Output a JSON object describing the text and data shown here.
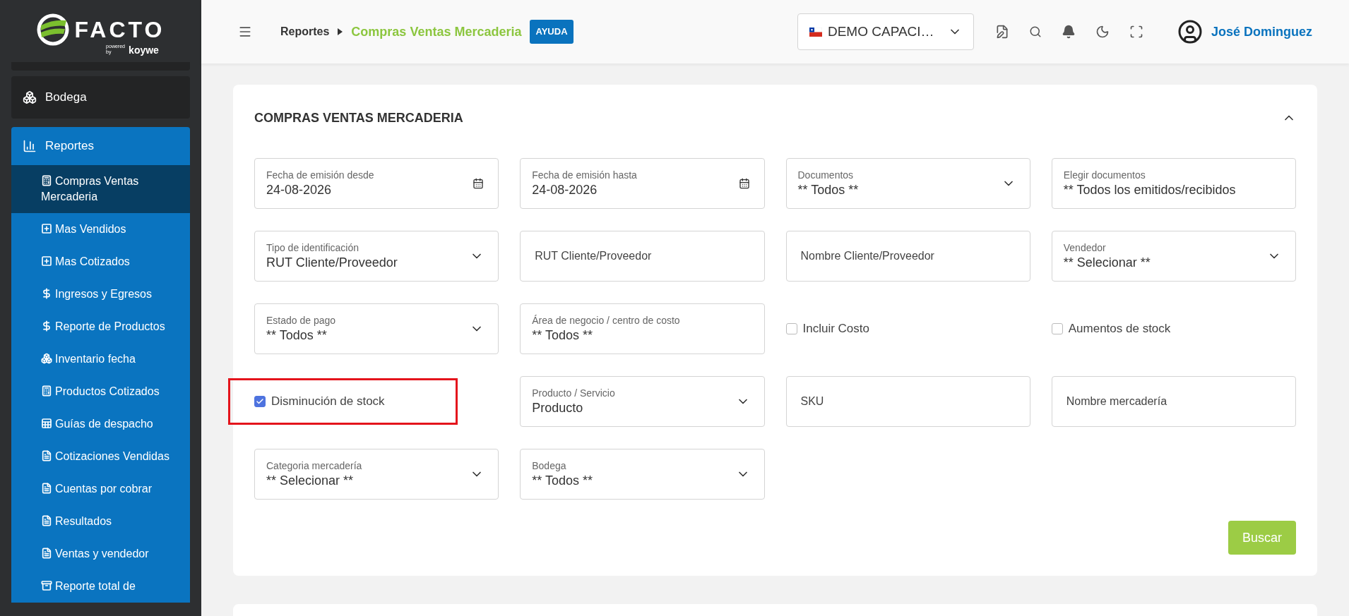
{
  "sidebar": {
    "logo": {
      "name": "FACTO",
      "tagline_small": "powered by",
      "tagline": "koywe"
    },
    "items": [
      {
        "label": "Bodega",
        "expanded": false
      },
      {
        "label": "Reportes",
        "expanded": true,
        "children": [
          {
            "label": "Compras Ventas Mercaderia",
            "selected": true
          },
          {
            "label": "Mas Vendidos",
            "selected": false
          },
          {
            "label": "Mas Cotizados",
            "selected": false
          },
          {
            "label": "Ingresos y Egresos",
            "selected": false
          },
          {
            "label": "Reporte de Productos",
            "selected": false
          },
          {
            "label": "Inventario fecha",
            "selected": false
          },
          {
            "label": "Productos Cotizados",
            "selected": false
          },
          {
            "label": "Guías de despacho",
            "selected": false
          },
          {
            "label": "Cotizaciones Vendidas",
            "selected": false
          },
          {
            "label": "Cuentas por cobrar",
            "selected": false
          },
          {
            "label": "Resultados",
            "selected": false
          },
          {
            "label": "Ventas y vendedor",
            "selected": false
          },
          {
            "label": "Reporte total de",
            "selected": false
          }
        ]
      }
    ]
  },
  "topbar": {
    "breadcrumb": [
      "Reportes",
      "Compras Ventas Mercaderia"
    ],
    "help": "AYUDA",
    "company": "DEMO CAPACI…",
    "user": "José Dominguez"
  },
  "card": {
    "title": "COMPRAS VENTAS MERCADERIA",
    "expanded": true,
    "fields": [
      {
        "kind": "date",
        "label": "Fecha de emisión desde",
        "value": "24-08-2026"
      },
      {
        "kind": "date",
        "label": "Fecha de emisión hasta",
        "value": "24-08-2026"
      },
      {
        "kind": "select",
        "label": "Documentos",
        "value": "** Todos **"
      },
      {
        "kind": "multiselect",
        "label": "Elegir documentos",
        "value": "** Todos los emitidos/recibidos"
      },
      {
        "kind": "select",
        "label": "Tipo de identificación",
        "value": "RUT Cliente/Proveedor"
      },
      {
        "kind": "text",
        "placeholder": "RUT Cliente/Proveedor"
      },
      {
        "kind": "text",
        "placeholder": "Nombre Cliente/Proveedor"
      },
      {
        "kind": "select",
        "label": "Vendedor",
        "value": "** Selecionar **"
      },
      {
        "kind": "select",
        "label": "Estado de pago",
        "value": "** Todos **"
      },
      {
        "kind": "multiselect",
        "label": "Área de negocio / centro de costo",
        "value": "** Todos **"
      },
      {
        "kind": "checkbox",
        "label": "Incluir Costo",
        "checked": false,
        "highlighted": false
      },
      {
        "kind": "checkbox",
        "label": "Aumentos de stock",
        "checked": false,
        "highlighted": false
      },
      {
        "kind": "checkbox",
        "label": "Disminución de stock",
        "checked": true,
        "highlighted": true
      },
      {
        "kind": "select",
        "label": "Producto / Servicio",
        "value": "Producto"
      },
      {
        "kind": "text",
        "placeholder": "SKU"
      },
      {
        "kind": "text",
        "placeholder": "Nombre mercadería"
      },
      {
        "kind": "select",
        "label": "Categoria mercadería",
        "value": "** Selecionar **"
      },
      {
        "kind": "select",
        "label": "Bodega",
        "value": "** Todos **"
      }
    ],
    "button": "Buscar"
  }
}
